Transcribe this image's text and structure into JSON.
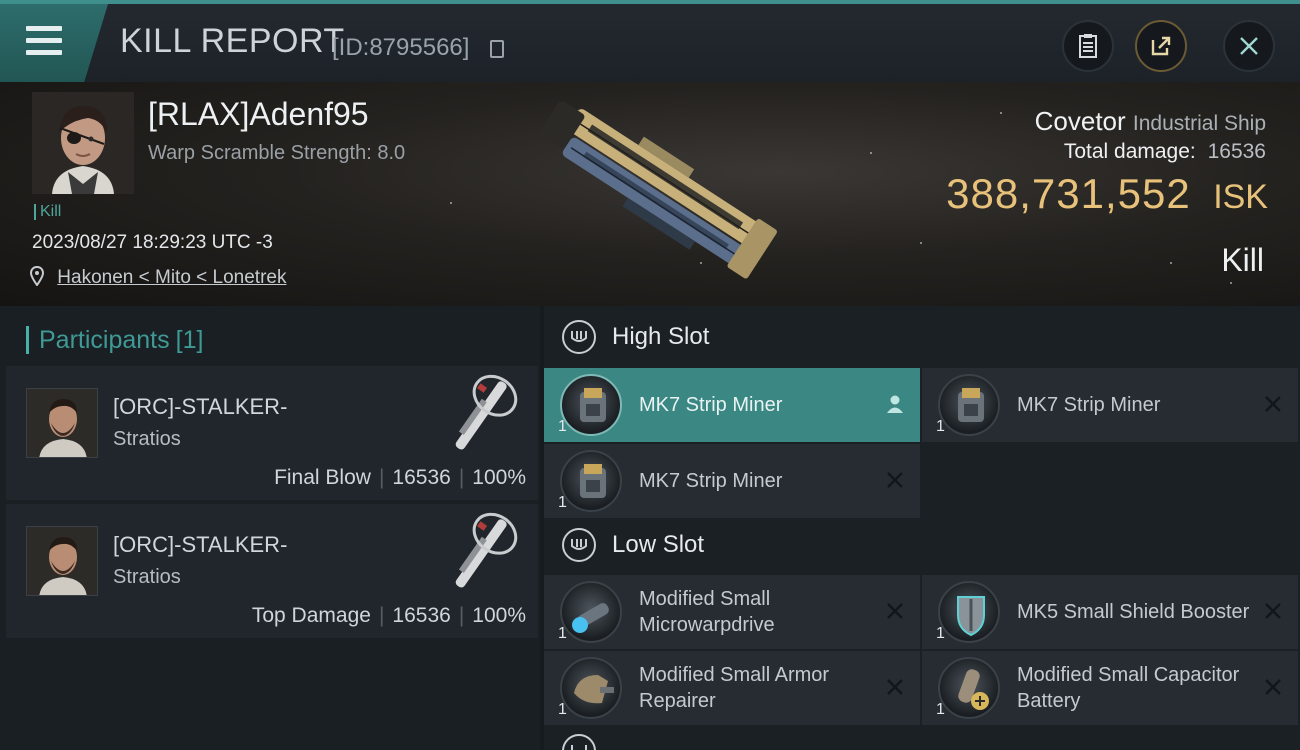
{
  "header": {
    "title": "KILL REPORT",
    "report_id": "[ID:8795566]"
  },
  "victim": {
    "name": "[RLAX]Adenf95",
    "warp_scramble": "Warp Scramble Strength: 8.0",
    "tag": "Kill",
    "datetime": "2023/08/27 18:29:23 UTC -3",
    "location": "Hakonen < Mito < Lonetrek",
    "ship_name": "Covetor",
    "ship_class": "Industrial Ship",
    "total_damage_label": "Total damage:",
    "total_damage": "16536",
    "isk_value": "388,731,552",
    "isk_unit": "ISK",
    "result": "Kill"
  },
  "participants": {
    "title": "Participants",
    "count": "[1]",
    "rows": [
      {
        "name": "[ORC]-STALKER-",
        "ship": "Stratios",
        "role": "Final Blow",
        "damage": "16536",
        "percent": "100%"
      },
      {
        "name": "[ORC]-STALKER-",
        "ship": "Stratios",
        "role": "Top Damage",
        "damage": "16536",
        "percent": "100%"
      }
    ]
  },
  "slots": {
    "high": {
      "title": "High Slot",
      "modules": [
        {
          "name": "MK7 Strip Miner",
          "qty": "1"
        },
        {
          "name": "MK7 Strip Miner",
          "qty": "1"
        },
        {
          "name": "MK7 Strip Miner",
          "qty": "1"
        }
      ]
    },
    "low": {
      "title": "Low Slot",
      "modules": [
        {
          "name": "Modified Small Microwarpdrive",
          "qty": "1"
        },
        {
          "name": "MK5 Small Shield Booster",
          "qty": "1"
        },
        {
          "name": "Modified Small Armor Repairer",
          "qty": "1"
        },
        {
          "name": "Modified Small Capacitor Battery",
          "qty": "1"
        }
      ]
    }
  },
  "colors": {
    "accent": "#3f8f8c",
    "isk": "#e8c27a",
    "active_module": "#3b8784"
  },
  "icons": [
    "menu-icon",
    "copy-icon",
    "clipboard-icon",
    "share-icon",
    "close-icon",
    "location-pin-icon",
    "slot-icon",
    "person-icon"
  ]
}
